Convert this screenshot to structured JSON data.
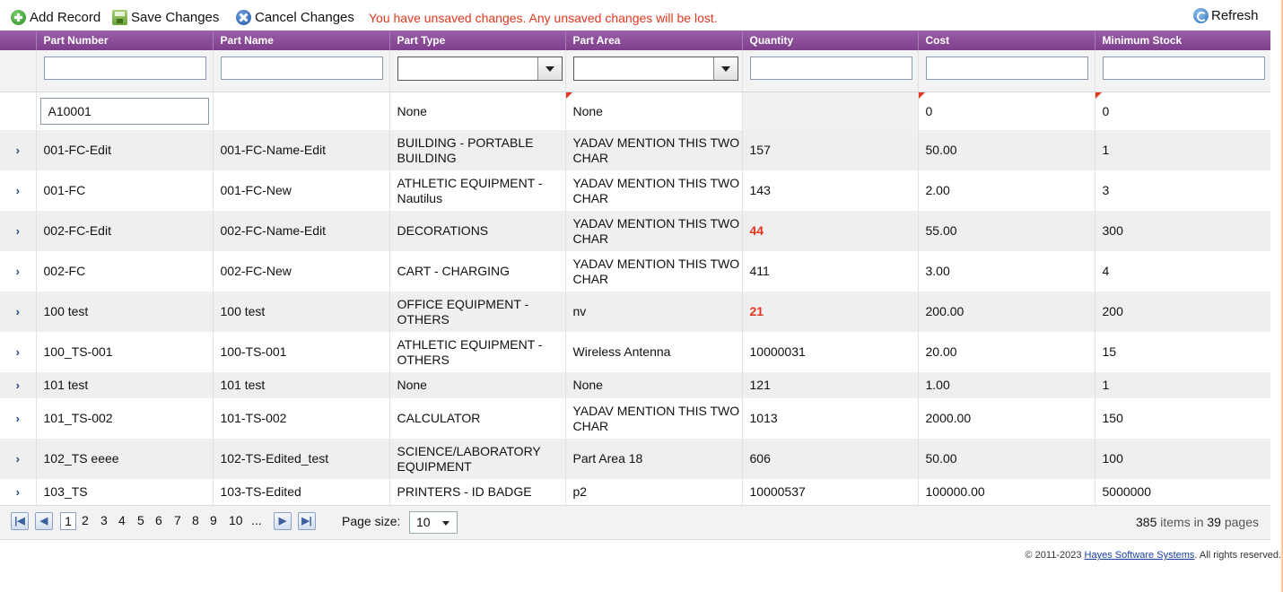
{
  "toolbar": {
    "add_label": "Add Record",
    "save_label": "Save Changes",
    "cancel_label": "Cancel Changes",
    "warning": "You have unsaved changes. Any unsaved changes will be lost.",
    "refresh_label": "Refresh"
  },
  "columns": [
    "Part Number",
    "Part Name",
    "Part Type",
    "Part Area",
    "Quantity",
    "Cost",
    "Minimum Stock"
  ],
  "new_row": {
    "part_number": "A10001",
    "part_name": "",
    "part_type": "None",
    "part_area": "None",
    "quantity": "",
    "cost": "0",
    "min_stock": "0"
  },
  "rows": [
    {
      "part_number": "001-FC-Edit",
      "part_name": "001-FC-Name-Edit",
      "part_type": "BUILDING - PORTABLE BUILDING",
      "part_area": "YADAV MENTION THIS TWO CHAR",
      "quantity": "157",
      "cost": "50.00",
      "min_stock": "1"
    },
    {
      "part_number": "001-FC",
      "part_name": "001-FC-New",
      "part_type": "ATHLETIC EQUIPMENT - Nautilus",
      "part_area": "YADAV MENTION THIS TWO CHAR",
      "quantity": "143",
      "cost": "2.00",
      "min_stock": "3"
    },
    {
      "part_number": "002-FC-Edit",
      "part_name": "002-FC-Name-Edit",
      "part_type": "DECORATIONS",
      "part_area": "YADAV MENTION THIS TWO CHAR",
      "quantity": "44",
      "cost": "55.00",
      "min_stock": "300"
    },
    {
      "part_number": "002-FC",
      "part_name": "002-FC-New",
      "part_type": "CART - CHARGING",
      "part_area": "YADAV MENTION THIS TWO CHAR",
      "quantity": "411",
      "cost": "3.00",
      "min_stock": "4"
    },
    {
      "part_number": "100 test",
      "part_name": "100 test",
      "part_type": "OFFICE EQUIPMENT - OTHERS",
      "part_area": "nv",
      "quantity": "21",
      "cost": "200.00",
      "min_stock": "200"
    },
    {
      "part_number": "100_TS-001",
      "part_name": "100-TS-001",
      "part_type": "ATHLETIC EQUIPMENT - OTHERS",
      "part_area": "Wireless Antenna",
      "quantity": "10000031",
      "cost": "20.00",
      "min_stock": "15"
    },
    {
      "part_number": "101 test",
      "part_name": "101 test",
      "part_type": "None",
      "part_area": "None",
      "quantity": "121",
      "cost": "1.00",
      "min_stock": "1"
    },
    {
      "part_number": "101_TS-002",
      "part_name": "101-TS-002",
      "part_type": "CALCULATOR",
      "part_area": "YADAV MENTION THIS TWO CHAR",
      "quantity": "1013",
      "cost": "2000.00",
      "min_stock": "150"
    },
    {
      "part_number": "102_TS eeee",
      "part_name": "102-TS-Edited_test",
      "part_type": "SCIENCE/LABORATORY EQUIPMENT",
      "part_area": "Part Area 18",
      "quantity": "606",
      "cost": "50.00",
      "min_stock": "100"
    },
    {
      "part_number": "103_TS",
      "part_name": "103-TS-Edited",
      "part_type": "PRINTERS - ID BADGE",
      "part_area": "p2",
      "quantity": "10000537",
      "cost": "100000.00",
      "min_stock": "5000000"
    }
  ],
  "pager": {
    "pages": [
      "1",
      "2",
      "3",
      "4",
      "5",
      "6",
      "7",
      "8",
      "9",
      "10",
      "..."
    ],
    "page_size_label": "Page size:",
    "page_size": "10",
    "total_items": "385",
    "items_label": "items in",
    "total_pages": "39",
    "pages_label": "pages"
  },
  "footer": {
    "prefix": "© 2011-2023",
    "company": "Hayes Software Systems",
    "suffix": ". All rights reserved."
  },
  "colors": {
    "header": "#8a4b98",
    "warning": "#e4361e",
    "alt_row": "#efefef"
  }
}
